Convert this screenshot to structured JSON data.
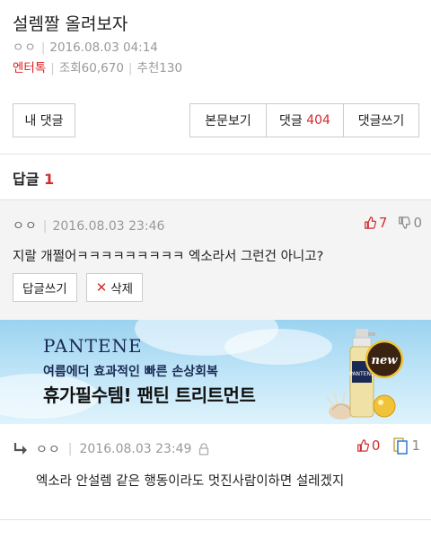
{
  "post": {
    "title": "설렘짤 올려보자",
    "author": "ㅇㅇ",
    "date": "2016.08.03 04:14",
    "category": "엔터톡",
    "views": "조회60,670",
    "recommends": "추천130"
  },
  "toolbar": {
    "my_comments": "내 댓글",
    "view_post": "본문보기",
    "comments_label": "댓글",
    "comments_count": "404",
    "write_comment": "댓글쓰기"
  },
  "replies_header": {
    "label": "답글",
    "count": "1"
  },
  "reply": {
    "author": "ㅇㅇ",
    "date": "2016.08.03 23:46",
    "upvotes": "7",
    "downvotes": "0",
    "text": "지랄 개쩔어ㅋㅋㅋㅋㅋㅋㅋㅋㅋ 엑소라서 그런건 아니고?",
    "reply_button": "답글쓰기",
    "delete_button": "삭제"
  },
  "ad": {
    "brand": "PANTENE",
    "subtitle": "여름에더 효과적인 빠른 손상회복",
    "headline": "휴가필수템! 팬틴 트리트먼트",
    "badge": "new",
    "product_label": "PANTENE"
  },
  "sub_reply": {
    "author": "ㅇㅇ",
    "date": "2016.08.03 23:49",
    "upvotes": "0",
    "downvotes": "1",
    "text": "엑소라 안설렘 같은 행동이라도 멋진사람이하면 설레겠지"
  },
  "colors": {
    "accent_red": "#d12c2c",
    "ad_blue": "#9bd3f0",
    "navy": "#1b2a55"
  }
}
